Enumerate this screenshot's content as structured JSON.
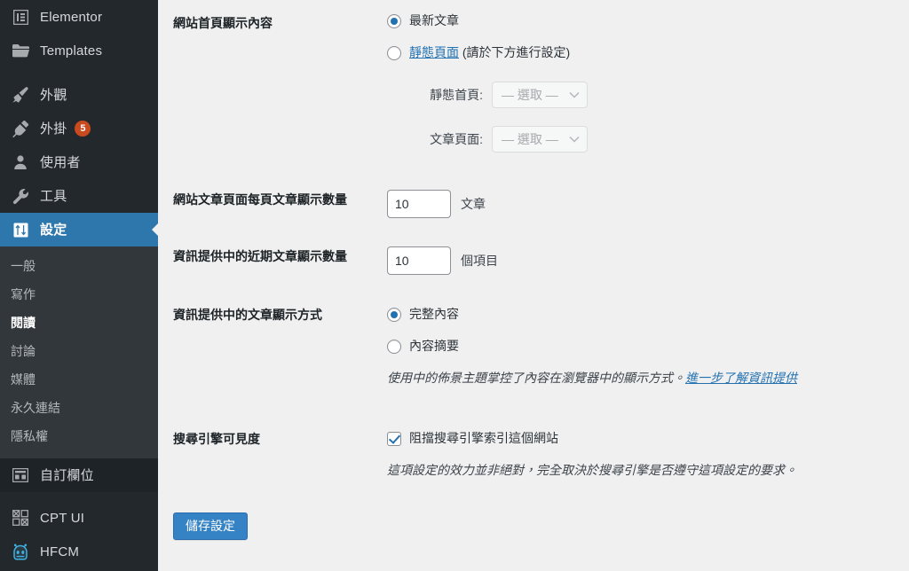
{
  "sidebar": {
    "items": [
      {
        "label": "Elementor",
        "icon": "elementor-icon",
        "latin": true
      },
      {
        "label": "Templates",
        "icon": "folder-icon",
        "latin": true
      },
      {
        "label": "外觀",
        "icon": "appearance-brush-icon"
      },
      {
        "label": "外掛",
        "icon": "plugins-plug-icon",
        "badge": "5"
      },
      {
        "label": "使用者",
        "icon": "users-icon"
      },
      {
        "label": "工具",
        "icon": "tools-wrench-icon"
      },
      {
        "label": "設定",
        "icon": "settings-sliders-icon",
        "active": true
      }
    ],
    "submenu": [
      {
        "label": "一般"
      },
      {
        "label": "寫作"
      },
      {
        "label": "閱讀",
        "current": true
      },
      {
        "label": "討論"
      },
      {
        "label": "媒體"
      },
      {
        "label": "永久連結"
      },
      {
        "label": "隱私權"
      }
    ],
    "bottom_items": [
      {
        "label": "自訂欄位",
        "icon": "custom-fields-icon",
        "dark": true
      },
      {
        "label": "CPT UI",
        "icon": "cpt-ui-blocks-icon",
        "latin": true
      },
      {
        "label": "HFCM",
        "icon": "hfcm-robot-icon",
        "latin": true
      }
    ]
  },
  "settings": {
    "front_page": {
      "label": "網站首頁顯示內容",
      "option_posts": "最新文章",
      "option_static_link": "靜態頁面",
      "option_static_suffix": "(請於下方進行設定)",
      "static_home_label": "靜態首頁:",
      "static_home_value": "— 選取 —",
      "posts_page_label": "文章頁面:",
      "posts_page_value": "— 選取 —"
    },
    "posts_per_page": {
      "label": "網站文章頁面每頁文章顯示數量",
      "value": "10",
      "unit": "文章"
    },
    "posts_per_rss": {
      "label": "資訊提供中的近期文章顯示數量",
      "value": "10",
      "unit": "個項目"
    },
    "rss_use_excerpt": {
      "label": "資訊提供中的文章顯示方式",
      "option_full": "完整內容",
      "option_excerpt": "內容摘要",
      "description": "使用中的佈景主題掌控了內容在瀏覽器中的顯示方式。",
      "description_link": "進一步了解資訊提供"
    },
    "search_visibility": {
      "label": "搜尋引擎可見度",
      "checkbox_label": "阻擋搜尋引擎索引這個網站",
      "description": "這項設定的效力並非絕對，完全取決於搜尋引擎是否遵守這項設定的要求。"
    },
    "submit_label": "儲存設定"
  },
  "colors": {
    "sidebar_bg": "#23282d",
    "submenu_bg": "#32373c",
    "active_blue": "#2e77ac",
    "accent_blue": "#2271b1",
    "badge_orange": "#ca4a1f",
    "page_bg": "#f0f0f1"
  }
}
